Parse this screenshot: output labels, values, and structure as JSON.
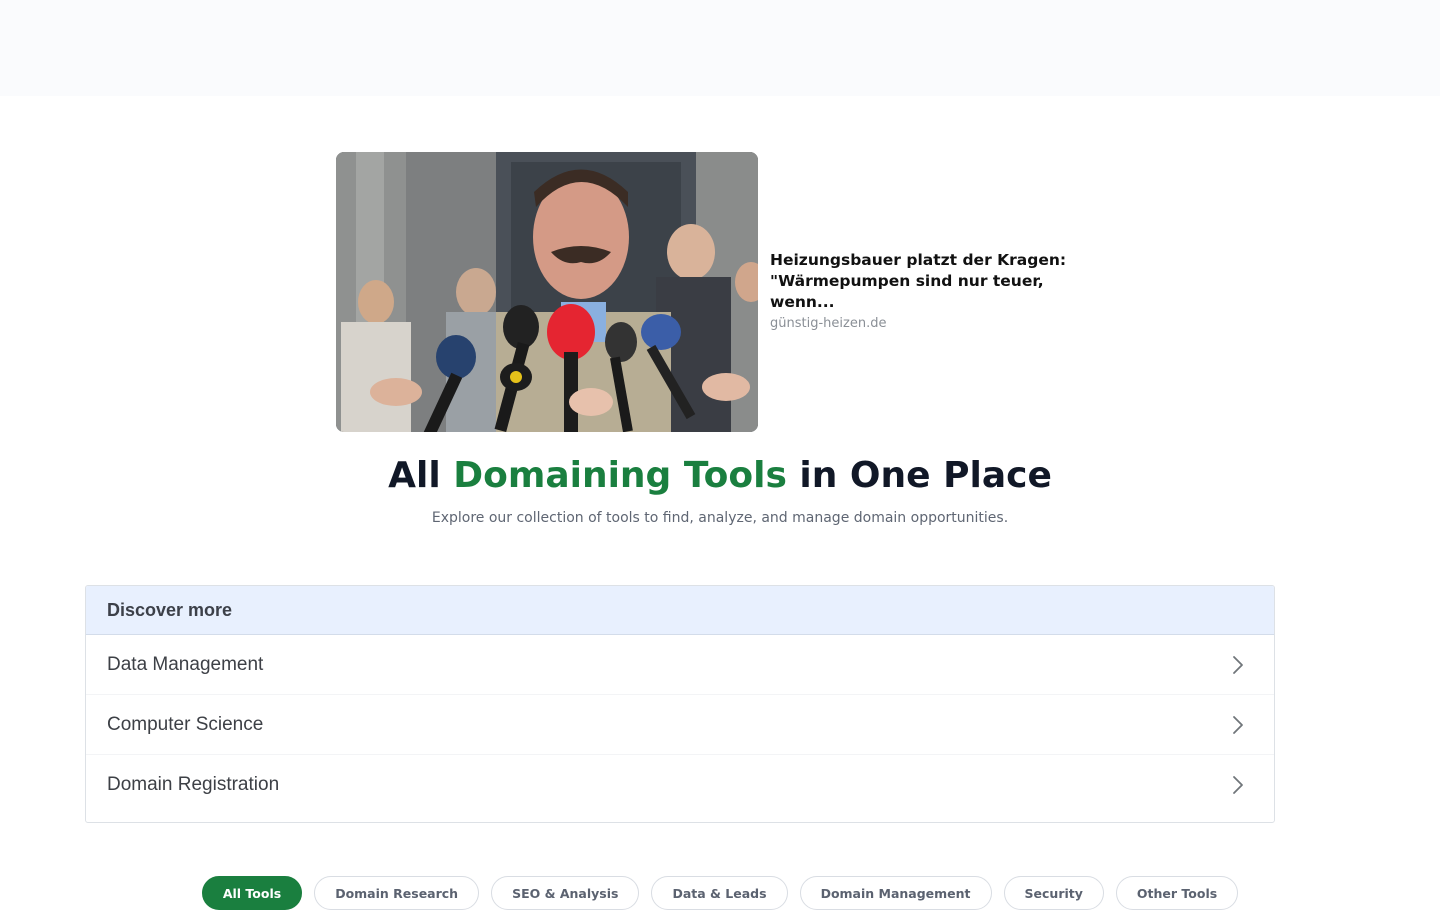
{
  "ad": {
    "headline": "Heizungsbauer platzt der Kragen: \"Wärmepumpen sind nur teuer, wenn...",
    "source": "günstig-heizen.de"
  },
  "hero": {
    "title_prefix": "All ",
    "title_accent": "Domaining Tools",
    "title_suffix": " in One Place",
    "subtitle": "Explore our collection of tools to find, analyze, and manage domain opportunities.",
    "accent_color": "#1a7f3f"
  },
  "discover": {
    "title": "Discover more",
    "items": [
      {
        "label": "Data Management",
        "icon": "chevron-right-icon"
      },
      {
        "label": "Computer Science",
        "icon": "chevron-right-icon"
      },
      {
        "label": "Domain Registration",
        "icon": "chevron-right-icon"
      }
    ]
  },
  "filters": [
    {
      "label": "All Tools",
      "active": true
    },
    {
      "label": "Domain Research",
      "active": false
    },
    {
      "label": "SEO & Analysis",
      "active": false
    },
    {
      "label": "Data & Leads",
      "active": false
    },
    {
      "label": "Domain Management",
      "active": false
    },
    {
      "label": "Security",
      "active": false
    },
    {
      "label": "Other Tools",
      "active": false
    }
  ]
}
